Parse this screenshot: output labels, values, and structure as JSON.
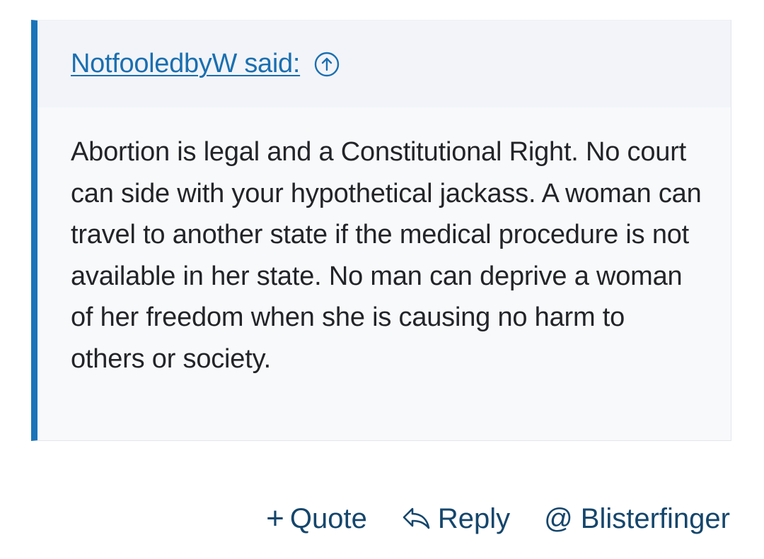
{
  "quote": {
    "attribution": "NotfooledbyW said:",
    "jump_icon": "arrow-up-circle-icon",
    "body": "Abortion is legal and a Constitutional Right. No court can side with your hypothetical jackass. A woman can travel to another state if the medical procedure is not available in her state. No man can deprive a woman of her freedom when she is causing no harm to others or society."
  },
  "actions": {
    "quote_icon": "plus-icon",
    "quote_label": "Quote",
    "reply_icon": "reply-arrow-icon",
    "reply_label": "Reply",
    "mention_label": "@ Blisterfinger"
  },
  "colors": {
    "accent": "#1a74b9",
    "link": "#1a6fb0",
    "action_text": "#15466c",
    "quote_bg": "#f8f9fb",
    "quote_header_bg": "#f2f4f9",
    "body_text": "#222428"
  }
}
